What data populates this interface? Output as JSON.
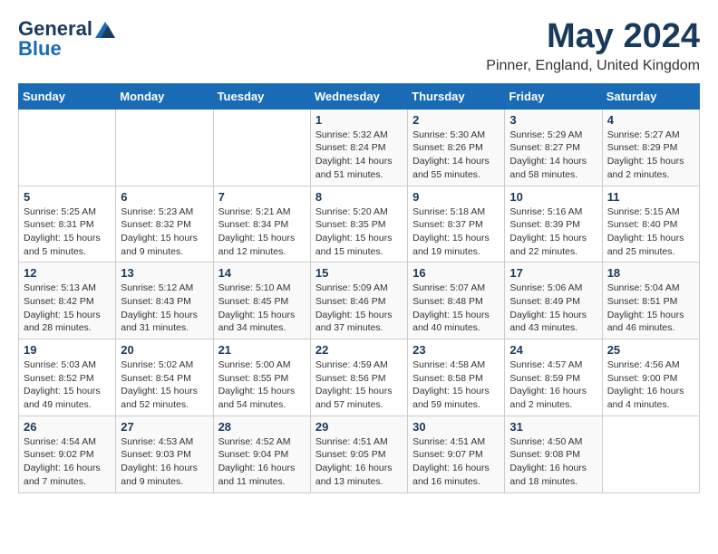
{
  "header": {
    "logo_line1": "General",
    "logo_line2": "Blue",
    "title": "May 2024",
    "subtitle": "Pinner, England, United Kingdom"
  },
  "calendar": {
    "days_of_week": [
      "Sunday",
      "Monday",
      "Tuesday",
      "Wednesday",
      "Thursday",
      "Friday",
      "Saturday"
    ],
    "weeks": [
      {
        "days": [
          {
            "date": "",
            "info": ""
          },
          {
            "date": "",
            "info": ""
          },
          {
            "date": "",
            "info": ""
          },
          {
            "date": "1",
            "info": "Sunrise: 5:32 AM\nSunset: 8:24 PM\nDaylight: 14 hours\nand 51 minutes."
          },
          {
            "date": "2",
            "info": "Sunrise: 5:30 AM\nSunset: 8:26 PM\nDaylight: 14 hours\nand 55 minutes."
          },
          {
            "date": "3",
            "info": "Sunrise: 5:29 AM\nSunset: 8:27 PM\nDaylight: 14 hours\nand 58 minutes."
          },
          {
            "date": "4",
            "info": "Sunrise: 5:27 AM\nSunset: 8:29 PM\nDaylight: 15 hours\nand 2 minutes."
          }
        ]
      },
      {
        "days": [
          {
            "date": "5",
            "info": "Sunrise: 5:25 AM\nSunset: 8:31 PM\nDaylight: 15 hours\nand 5 minutes."
          },
          {
            "date": "6",
            "info": "Sunrise: 5:23 AM\nSunset: 8:32 PM\nDaylight: 15 hours\nand 9 minutes."
          },
          {
            "date": "7",
            "info": "Sunrise: 5:21 AM\nSunset: 8:34 PM\nDaylight: 15 hours\nand 12 minutes."
          },
          {
            "date": "8",
            "info": "Sunrise: 5:20 AM\nSunset: 8:35 PM\nDaylight: 15 hours\nand 15 minutes."
          },
          {
            "date": "9",
            "info": "Sunrise: 5:18 AM\nSunset: 8:37 PM\nDaylight: 15 hours\nand 19 minutes."
          },
          {
            "date": "10",
            "info": "Sunrise: 5:16 AM\nSunset: 8:39 PM\nDaylight: 15 hours\nand 22 minutes."
          },
          {
            "date": "11",
            "info": "Sunrise: 5:15 AM\nSunset: 8:40 PM\nDaylight: 15 hours\nand 25 minutes."
          }
        ]
      },
      {
        "days": [
          {
            "date": "12",
            "info": "Sunrise: 5:13 AM\nSunset: 8:42 PM\nDaylight: 15 hours\nand 28 minutes."
          },
          {
            "date": "13",
            "info": "Sunrise: 5:12 AM\nSunset: 8:43 PM\nDaylight: 15 hours\nand 31 minutes."
          },
          {
            "date": "14",
            "info": "Sunrise: 5:10 AM\nSunset: 8:45 PM\nDaylight: 15 hours\nand 34 minutes."
          },
          {
            "date": "15",
            "info": "Sunrise: 5:09 AM\nSunset: 8:46 PM\nDaylight: 15 hours\nand 37 minutes."
          },
          {
            "date": "16",
            "info": "Sunrise: 5:07 AM\nSunset: 8:48 PM\nDaylight: 15 hours\nand 40 minutes."
          },
          {
            "date": "17",
            "info": "Sunrise: 5:06 AM\nSunset: 8:49 PM\nDaylight: 15 hours\nand 43 minutes."
          },
          {
            "date": "18",
            "info": "Sunrise: 5:04 AM\nSunset: 8:51 PM\nDaylight: 15 hours\nand 46 minutes."
          }
        ]
      },
      {
        "days": [
          {
            "date": "19",
            "info": "Sunrise: 5:03 AM\nSunset: 8:52 PM\nDaylight: 15 hours\nand 49 minutes."
          },
          {
            "date": "20",
            "info": "Sunrise: 5:02 AM\nSunset: 8:54 PM\nDaylight: 15 hours\nand 52 minutes."
          },
          {
            "date": "21",
            "info": "Sunrise: 5:00 AM\nSunset: 8:55 PM\nDaylight: 15 hours\nand 54 minutes."
          },
          {
            "date": "22",
            "info": "Sunrise: 4:59 AM\nSunset: 8:56 PM\nDaylight: 15 hours\nand 57 minutes."
          },
          {
            "date": "23",
            "info": "Sunrise: 4:58 AM\nSunset: 8:58 PM\nDaylight: 15 hours\nand 59 minutes."
          },
          {
            "date": "24",
            "info": "Sunrise: 4:57 AM\nSunset: 8:59 PM\nDaylight: 16 hours\nand 2 minutes."
          },
          {
            "date": "25",
            "info": "Sunrise: 4:56 AM\nSunset: 9:00 PM\nDaylight: 16 hours\nand 4 minutes."
          }
        ]
      },
      {
        "days": [
          {
            "date": "26",
            "info": "Sunrise: 4:54 AM\nSunset: 9:02 PM\nDaylight: 16 hours\nand 7 minutes."
          },
          {
            "date": "27",
            "info": "Sunrise: 4:53 AM\nSunset: 9:03 PM\nDaylight: 16 hours\nand 9 minutes."
          },
          {
            "date": "28",
            "info": "Sunrise: 4:52 AM\nSunset: 9:04 PM\nDaylight: 16 hours\nand 11 minutes."
          },
          {
            "date": "29",
            "info": "Sunrise: 4:51 AM\nSunset: 9:05 PM\nDaylight: 16 hours\nand 13 minutes."
          },
          {
            "date": "30",
            "info": "Sunrise: 4:51 AM\nSunset: 9:07 PM\nDaylight: 16 hours\nand 16 minutes."
          },
          {
            "date": "31",
            "info": "Sunrise: 4:50 AM\nSunset: 9:08 PM\nDaylight: 16 hours\nand 18 minutes."
          },
          {
            "date": "",
            "info": ""
          }
        ]
      }
    ]
  }
}
